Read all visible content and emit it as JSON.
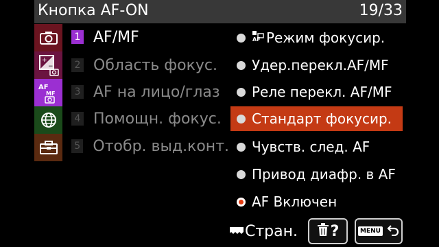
{
  "header": {
    "title": "Кнопка AF-ON",
    "page": "19/33"
  },
  "categories": [
    {
      "name": "camera-icon",
      "color": "#6b1420"
    },
    {
      "name": "exposure-camera-icon",
      "color": "#6b1440"
    },
    {
      "name": "af-mf-camera-icon",
      "color": "#9b2fd2",
      "text_top": "AF",
      "text_sub": "MF"
    },
    {
      "name": "globe-icon",
      "color": "#1a4a1a"
    },
    {
      "name": "toolbox-icon",
      "color": "#5a2a10"
    }
  ],
  "menu": {
    "items": [
      {
        "num": "1",
        "label": "AF/MF"
      },
      {
        "num": "2",
        "label": "Область фокус."
      },
      {
        "num": "3",
        "label": "AF на лицо/глаз"
      },
      {
        "num": "4",
        "label": "Помощн. фокус."
      },
      {
        "num": "5",
        "label": "Отобр. выд.конт."
      }
    ]
  },
  "options": [
    {
      "label": "Режим фокусир."
    },
    {
      "label": "Удер.перекл.AF/MF"
    },
    {
      "label": "Реле перекл. AF/MF"
    },
    {
      "label": "Стандарт фокусир."
    },
    {
      "label": "Чувств. след. AF"
    },
    {
      "label": "Привод диафр. в AF"
    },
    {
      "label": "AF Включен"
    }
  ],
  "footer": {
    "pages_label": "Стран.",
    "help_symbol": "?",
    "menu_chip": "MENU"
  },
  "colors": {
    "accent": "#9b2fd2",
    "selection": "#c43a14",
    "header": "#383838"
  }
}
